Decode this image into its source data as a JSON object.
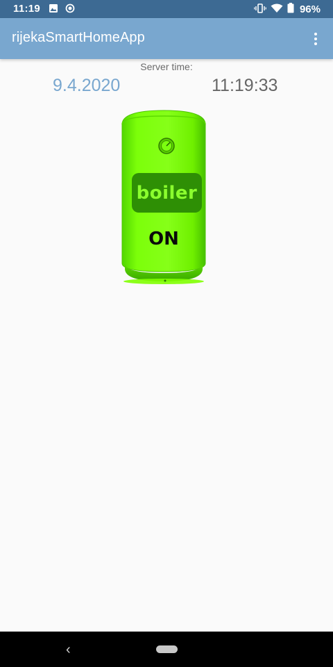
{
  "status_bar": {
    "time": "11:19",
    "battery": "96%",
    "left_icons": [
      "image-icon",
      "record-icon"
    ],
    "right_icons": [
      "vibrate-icon",
      "wifi-icon",
      "battery-icon"
    ]
  },
  "app_bar": {
    "title": "rijekaSmartHomeApp",
    "menu_icon": "overflow-menu-icon"
  },
  "server": {
    "label": "Server time:",
    "date": "9.4.2020",
    "time": "11:19:33"
  },
  "boiler": {
    "label": "boiler",
    "state": "ON",
    "body_color": "#7fff00",
    "label_bg": "#2e8f05",
    "label_color": "#8bff2e"
  },
  "colors": {
    "status_bar": "#3d6a93",
    "app_bar": "#79a7cf",
    "date_text": "#79a7cf",
    "time_text": "#666666",
    "background": "#fafafa"
  },
  "nav_bar": {
    "back_icon": "back-icon",
    "home_icon": "home-pill-icon"
  }
}
